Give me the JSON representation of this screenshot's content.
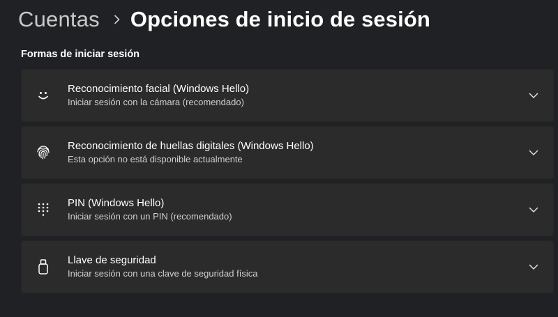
{
  "breadcrumb": {
    "parent": "Cuentas",
    "separator_icon": "chevron-right-icon",
    "current": "Opciones de inicio de sesión"
  },
  "section": {
    "title": "Formas de iniciar sesión"
  },
  "options": [
    {
      "icon": "face-smile-icon",
      "title": "Reconocimiento facial (Windows Hello)",
      "subtitle": "Iniciar sesión con la cámara (recomendado)"
    },
    {
      "icon": "fingerprint-icon",
      "title": "Reconocimiento de huellas digitales (Windows Hello)",
      "subtitle": "Esta opción no está disponible actualmente"
    },
    {
      "icon": "pin-keypad-icon",
      "title": "PIN (Windows Hello)",
      "subtitle": "Iniciar sesión con un PIN (recomendado)"
    },
    {
      "icon": "security-key-icon",
      "title": "Llave de seguridad",
      "subtitle": "Iniciar sesión con una clave de seguridad física"
    }
  ],
  "colors": {
    "background": "#202020",
    "card": "#2b2b2b",
    "text_primary": "#ffffff",
    "text_secondary": "#cfcfcf",
    "breadcrumb_parent": "#c9c9c9"
  }
}
